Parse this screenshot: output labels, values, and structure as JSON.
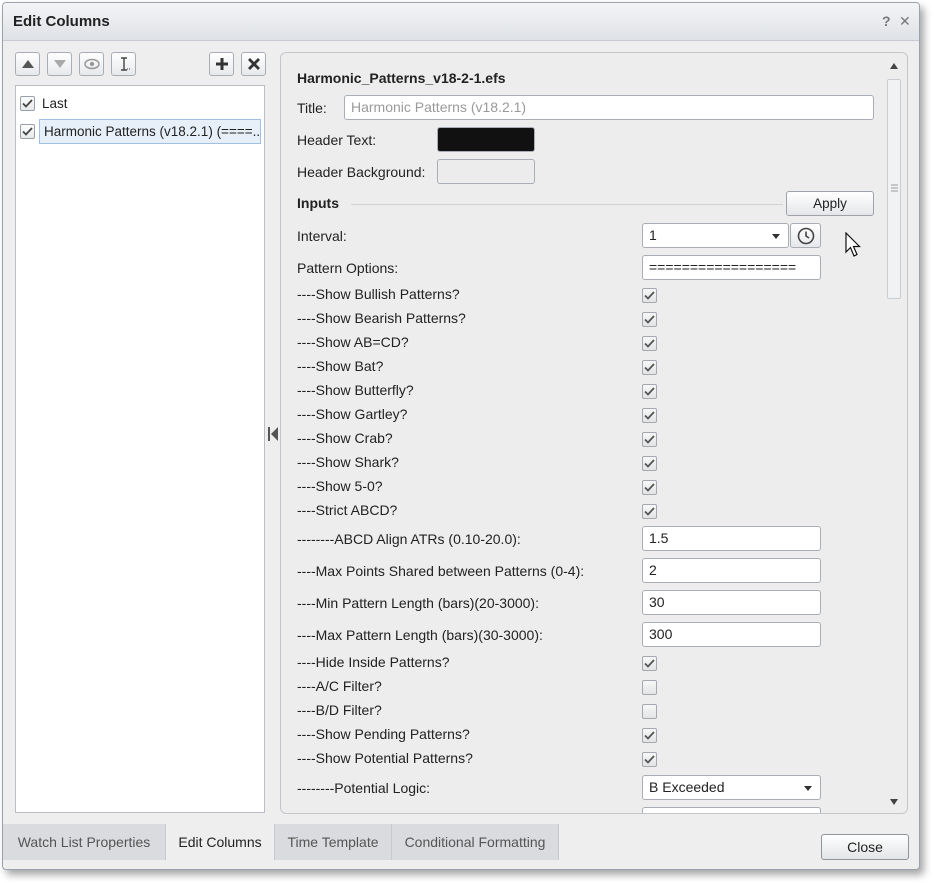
{
  "window": {
    "title": "Edit Columns",
    "help": "?",
    "close": "✕"
  },
  "toolbar": {
    "buttons": [
      "move-up",
      "move-down",
      "visibility",
      "rename",
      "add",
      "remove"
    ]
  },
  "columns": [
    {
      "label": "Last",
      "checked": true
    },
    {
      "label": "Harmonic Patterns (v18.2.1) (====...",
      "checked": true,
      "selected": true
    }
  ],
  "editor": {
    "file_name": "Harmonic_Patterns_v18-2-1.efs",
    "title_label": "Title:",
    "title_placeholder": "Harmonic Patterns (v18.2.1)",
    "header_text_label": "Header Text:",
    "header_text_color": "#111111",
    "header_bg_label": "Header Background:",
    "header_bg_color": "#ececec",
    "inputs_heading": "Inputs",
    "apply_label": "Apply",
    "interval_label": "Interval:",
    "interval_value": "1",
    "pattern_options_label": "Pattern Options:",
    "pattern_options_value": "==================",
    "checks": [
      {
        "label": "----Show Bullish Patterns?",
        "checked": true
      },
      {
        "label": "----Show Bearish Patterns?",
        "checked": true
      },
      {
        "label": "----Show AB=CD?",
        "checked": true
      },
      {
        "label": "----Show Bat?",
        "checked": true
      },
      {
        "label": "----Show Butterfly?",
        "checked": true
      },
      {
        "label": "----Show Gartley?",
        "checked": true
      },
      {
        "label": "----Show Crab?",
        "checked": true
      },
      {
        "label": "----Show Shark?",
        "checked": true
      },
      {
        "label": "----Show 5-0?",
        "checked": true
      },
      {
        "label": "----Strict ABCD?",
        "checked": true
      }
    ],
    "number_fields": [
      {
        "label": "--------ABCD Align ATRs (0.10-20.0):",
        "value": "1.5"
      },
      {
        "label": "----Max Points Shared between Patterns (0-4):",
        "value": "2"
      },
      {
        "label": "----Min Pattern Length (bars)(20-3000):",
        "value": "30"
      },
      {
        "label": "----Max Pattern Length (bars)(30-3000):",
        "value": "300"
      }
    ],
    "checks2": [
      {
        "label": "----Hide Inside Patterns?",
        "checked": true
      },
      {
        "label": "----A/C Filter?",
        "checked": false
      },
      {
        "label": "----B/D Filter?",
        "checked": false
      },
      {
        "label": "----Show Pending Patterns?",
        "checked": true
      },
      {
        "label": "----Show Potential Patterns?",
        "checked": true
      }
    ],
    "potential_logic_label": "--------Potential Logic:",
    "potential_logic_value": "B Exceeded"
  },
  "tabs": [
    {
      "label": "Watch List Properties",
      "active": false
    },
    {
      "label": "Edit Columns",
      "active": true
    },
    {
      "label": "Time Template",
      "active": false
    },
    {
      "label": "Conditional Formatting",
      "active": false
    }
  ],
  "footer": {
    "close_label": "Close"
  }
}
